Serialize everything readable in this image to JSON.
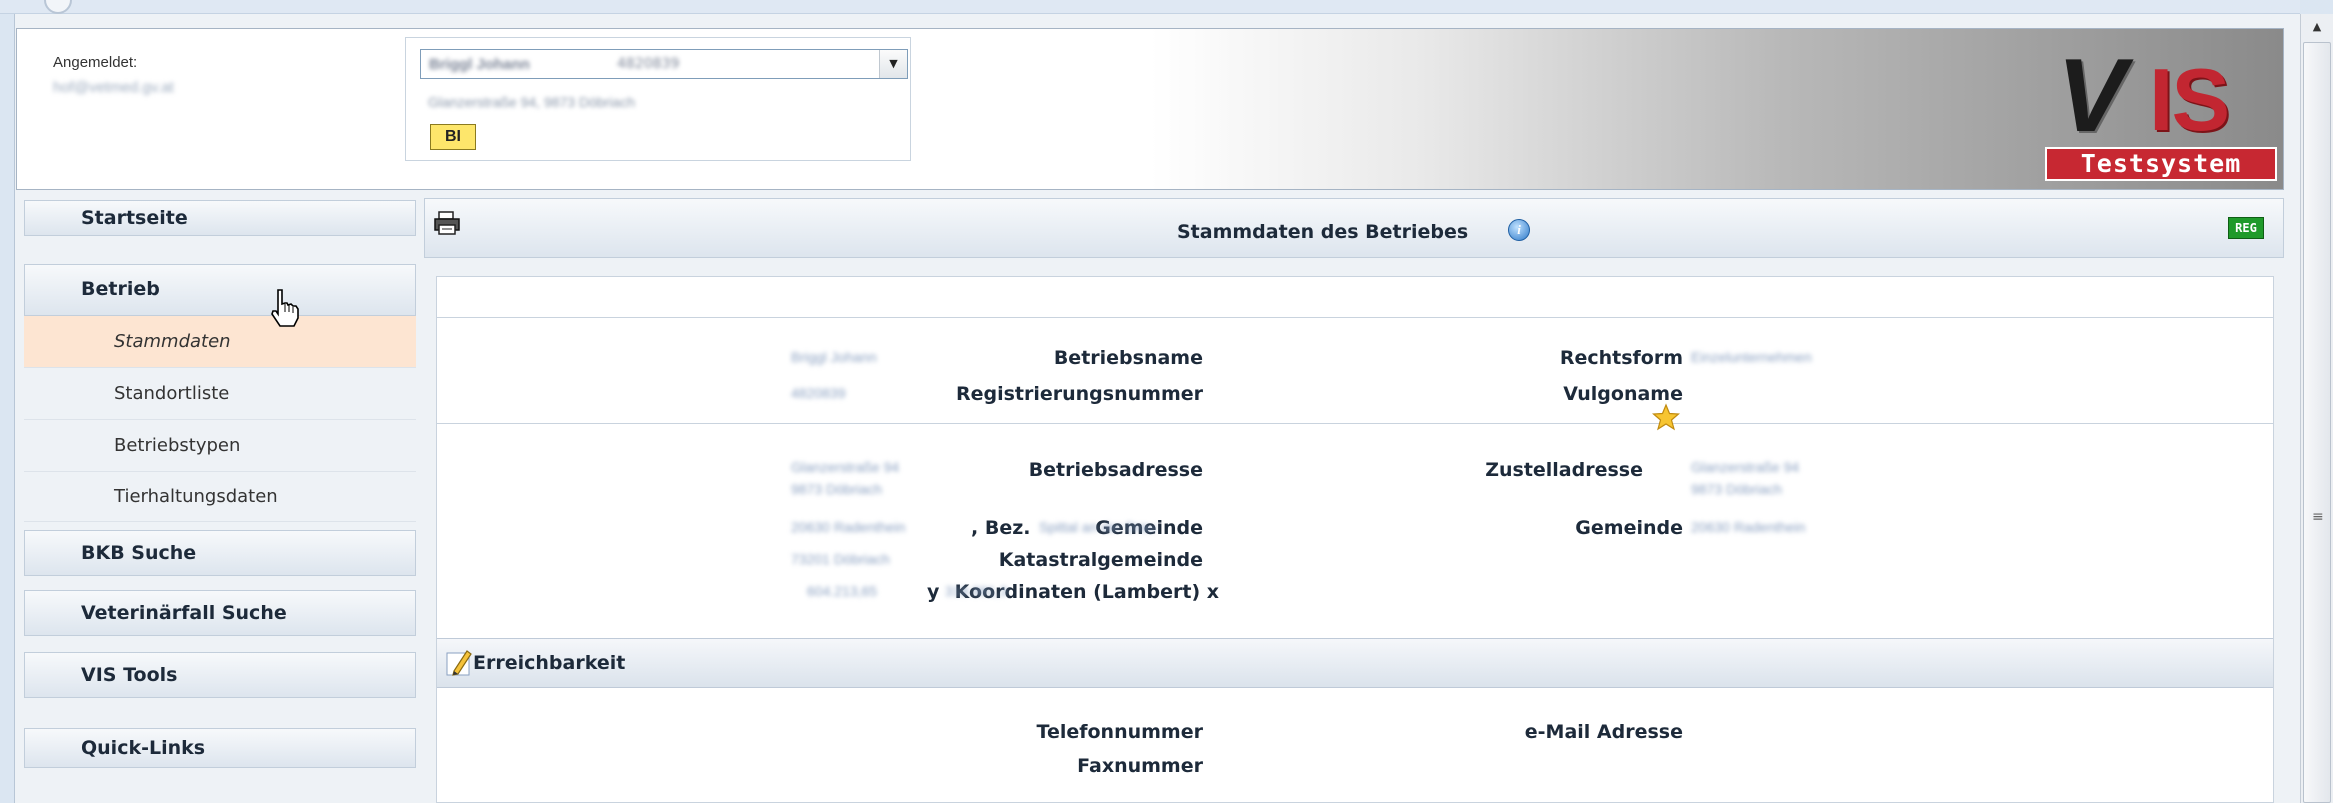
{
  "header": {
    "login_label": "Angemeldet:",
    "login_user": "hof@vetmed.gv.at",
    "company_select_value": "Briggl Johann",
    "company_select_id": "4820839",
    "company_address": "Glanzerstraße 94, 9873 Döbriach",
    "bi_badge": "BI",
    "logo_text": "VIS",
    "logo_subtitle": "Testsystem"
  },
  "sidebar": {
    "items": [
      {
        "label": "Startseite"
      },
      {
        "label": "Betrieb"
      },
      {
        "label": "BKB Suche"
      },
      {
        "label": "Veterinärfall Suche"
      },
      {
        "label": "VIS Tools"
      },
      {
        "label": "Quick-Links"
      }
    ],
    "betrieb_subitems": [
      {
        "label": "Stammdaten",
        "active": true
      },
      {
        "label": "Standortliste",
        "active": false
      },
      {
        "label": "Betriebstypen",
        "active": false
      },
      {
        "label": "Tierhaltungsdaten",
        "active": false
      }
    ]
  },
  "main": {
    "title": "Stammdaten des Betriebes",
    "reg_badge": "REG",
    "fields": {
      "betriebsname_label": "Betriebsname",
      "betriebsname_value": "Briggl Johann",
      "registrierungsnummer_label": "Registrierungsnummer",
      "registrierungsnummer_value": "4820839",
      "rechtsform_label": "Rechtsform",
      "rechtsform_value": "Einzelunternehmen",
      "vulgoname_label": "Vulgoname",
      "betriebsadresse_label": "Betriebsadresse",
      "betriebsadresse_line1": "Glanzerstraße 94",
      "betriebsadresse_line2": "9873 Döbriach",
      "zustelladresse_label": "Zustelladresse",
      "zustelladresse_line1": "Glanzerstraße 94",
      "zustelladresse_line2": "9873 Döbriach",
      "gemeinde_label": "Gemeinde",
      "gemeinde_value": "20630 Radenthein",
      "bez_label": ", Bez.",
      "bez_value": "Spittal an der Drau",
      "gemeinde2_label": "Gemeinde",
      "gemeinde2_value": "20630 Radenthein",
      "katastralgemeinde_label": "Katastralgemeinde",
      "katastralgemeinde_value": "73201 Döbriach",
      "koordinaten_label": "Koordinaten (Lambert) x",
      "koordinaten_x_value": "604.213,65",
      "koordinaten_y_label": "y",
      "koordinaten_y_value": "318.981,3"
    },
    "erreichbarkeit": {
      "title": "Erreichbarkeit",
      "telefon_label": "Telefonnummer",
      "fax_label": "Faxnummer",
      "email_label": "e-Mail Adresse"
    }
  },
  "colors": {
    "accent_red": "#c72832",
    "active_nav": "#fde5d2",
    "reg_green": "#1f9a2a",
    "bi_yellow": "#fde66b"
  },
  "icons": [
    "printer-icon",
    "info-icon",
    "star-icon",
    "pencil-icon",
    "hand-cursor-icon",
    "chevron-down-icon",
    "scroll-up-icon"
  ]
}
